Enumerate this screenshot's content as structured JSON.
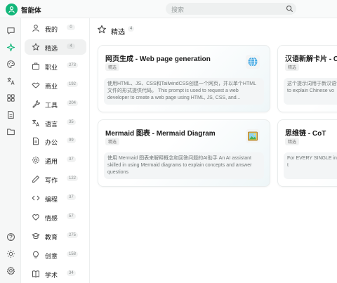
{
  "app": {
    "title": "智能体"
  },
  "search": {
    "placeholder": "搜索"
  },
  "rail": {
    "items": [
      {
        "icon": "chat-icon"
      },
      {
        "icon": "sparkle-icon",
        "active": true
      },
      {
        "icon": "palette-icon"
      },
      {
        "icon": "translate-icon"
      },
      {
        "icon": "grid-icon"
      },
      {
        "icon": "document-icon"
      },
      {
        "icon": "folder-icon"
      }
    ],
    "bottom": [
      {
        "icon": "help-icon"
      },
      {
        "icon": "sun-icon"
      },
      {
        "icon": "gear-icon"
      }
    ]
  },
  "categories": [
    {
      "label": "我的",
      "count": "0",
      "icon": "user-icon"
    },
    {
      "label": "精选",
      "count": "4",
      "icon": "star-icon",
      "active": true
    },
    {
      "label": "职业",
      "count": "273",
      "icon": "briefcase-icon"
    },
    {
      "label": "商业",
      "count": "192",
      "icon": "handshake-icon"
    },
    {
      "label": "工具",
      "count": "204",
      "icon": "wrench-icon"
    },
    {
      "label": "语言",
      "count": "35",
      "icon": "translate-icon"
    },
    {
      "label": "办公",
      "count": "99",
      "icon": "document-icon"
    },
    {
      "label": "通用",
      "count": "37",
      "icon": "settings-icon"
    },
    {
      "label": "写作",
      "count": "122",
      "icon": "pen-icon"
    },
    {
      "label": "编程",
      "count": "37",
      "icon": "code-icon"
    },
    {
      "label": "情感",
      "count": "57",
      "icon": "heart-icon"
    },
    {
      "label": "教育",
      "count": "275",
      "icon": "graduation-icon"
    },
    {
      "label": "创意",
      "count": "158",
      "icon": "lightbulb-icon"
    },
    {
      "label": "学术",
      "count": "34",
      "icon": "book-icon"
    }
  ],
  "main": {
    "title": "精选",
    "count": "4",
    "cards": [
      {
        "title": "网页生成 - Web page generation",
        "badge": "精选",
        "desc": "使用HTML、JS、CSS和TailwindCSS创建一个网页，并以单个HTML文件的形式提供代码。 This prompt is used to request a web developer to create a web page using HTML, JS, CSS, and...",
        "icon": "globe-icon"
      },
      {
        "title": "汉语新解卡片 - Chinese",
        "badge": "精选",
        "desc": "这个提示词用于新汉语词汇的解释卡片生成，将生成有解释的词语卡片 to explain Chinese vo",
        "icon": ""
      },
      {
        "title": "Mermaid 图表 - Mermaid Diagram",
        "badge": "精选",
        "desc": "使用 Mermaid 图表来解释概念和回答问题的AI助手 An AI assistant skilled in using Mermaid diagrams to explain concepts and answer questions",
        "icon": "picture-icon"
      },
      {
        "title": "思维链 - CoT",
        "badge": "精选",
        "desc": "For EVERY SINGLE inte engage in a comprehe before responding or t",
        "icon": ""
      }
    ]
  },
  "colors": {
    "accent": "#12b77a",
    "sidebar_bg": "#f6f7f7"
  }
}
